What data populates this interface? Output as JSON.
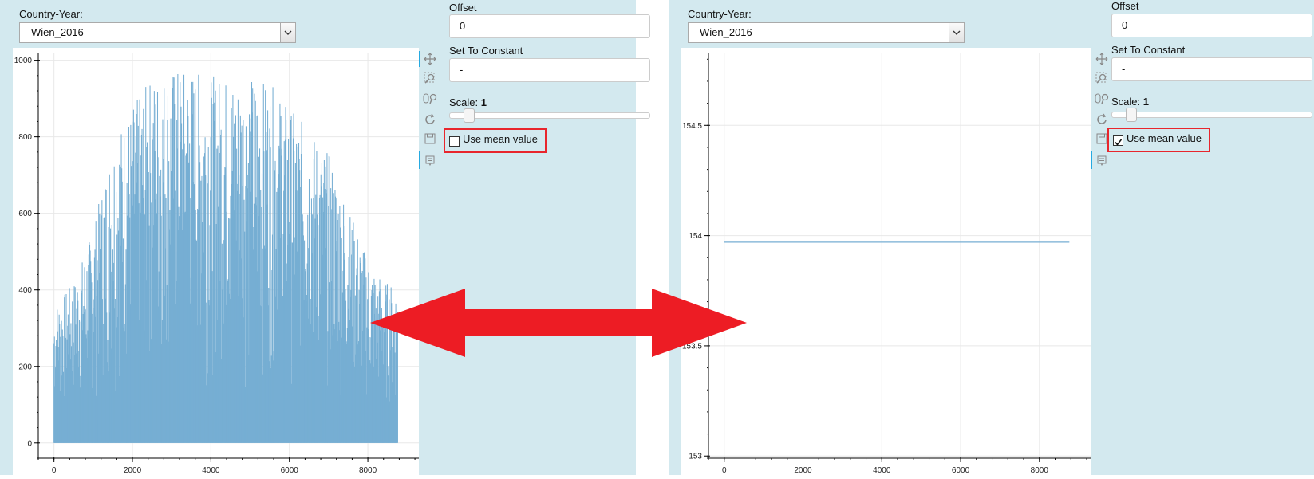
{
  "left": {
    "country_year_label": "Country-Year:",
    "country_year_value": "Wien_2016",
    "offset_label": "Offset",
    "offset_value": "0",
    "constant_label": "Set To Constant",
    "constant_value": "-",
    "scale_label": "Scale:",
    "scale_value": "1",
    "mean_label": "Use mean value",
    "mean_checked": false,
    "chart_data": {
      "type": "area",
      "y_ticks": [
        "0",
        "200",
        "400",
        "600",
        "800",
        "1000"
      ],
      "x_ticks": [
        "0",
        "2000",
        "4000",
        "6000",
        "8000"
      ],
      "xlim": [
        -400,
        9300
      ],
      "ylim": [
        -40,
        1020
      ],
      "x_range": [
        0,
        8760
      ],
      "approx_envelope": [
        [
          0,
          360
        ],
        [
          500,
          420
        ],
        [
          1000,
          560
        ],
        [
          1500,
          800
        ],
        [
          2000,
          880
        ],
        [
          2500,
          960
        ],
        [
          3000,
          980
        ],
        [
          3500,
          980
        ],
        [
          4000,
          960
        ],
        [
          4500,
          960
        ],
        [
          5000,
          960
        ],
        [
          5500,
          940
        ],
        [
          6000,
          880
        ],
        [
          6500,
          820
        ],
        [
          7000,
          760
        ],
        [
          7500,
          620
        ],
        [
          8000,
          480
        ],
        [
          8500,
          420
        ],
        [
          8760,
          410
        ]
      ],
      "color": "#76aed3"
    }
  },
  "right": {
    "country_year_label": "Country-Year:",
    "country_year_value": "Wien_2016",
    "offset_label": "Offset",
    "offset_value": "0",
    "constant_label": "Set To Constant",
    "constant_value": "-",
    "scale_label": "Scale:",
    "scale_value": "1",
    "mean_label": "Use mean value",
    "mean_checked": true,
    "chart_data": {
      "type": "line",
      "y_ticks": [
        "153",
        "153.5",
        "154",
        "154.5"
      ],
      "x_ticks": [
        "0",
        "2000",
        "4000",
        "6000",
        "8000"
      ],
      "xlim": [
        -400,
        9300
      ],
      "ylim": [
        152.99,
        154.83
      ],
      "series": [
        {
          "x": [
            0,
            8760
          ],
          "y": [
            153.97,
            153.97
          ]
        }
      ],
      "color": "#76aed3"
    }
  },
  "arrow_color": "#ed1c24",
  "highlight_color": "#e8262d"
}
